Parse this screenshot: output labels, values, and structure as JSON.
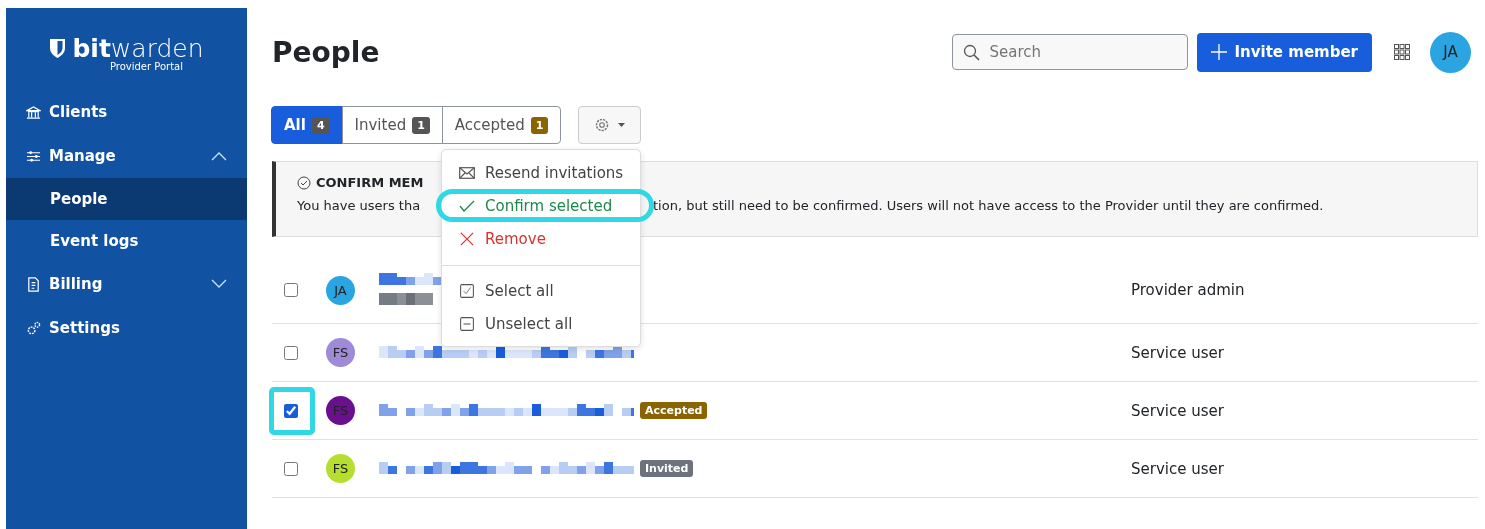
{
  "sidebar": {
    "logo": {
      "brand_bold": "bit",
      "brand_light": "warden",
      "subtitle": "Provider Portal"
    },
    "items": [
      {
        "label": "Clients",
        "selected": false
      },
      {
        "label": "Manage",
        "expanded": true,
        "selected": false,
        "children": [
          {
            "label": "People",
            "selected": true
          },
          {
            "label": "Event logs",
            "selected": false
          }
        ]
      },
      {
        "label": "Billing",
        "expanded": false,
        "selected": false
      },
      {
        "label": "Settings",
        "selected": false
      }
    ]
  },
  "header": {
    "title": "People",
    "search": {
      "placeholder": "Search"
    },
    "invite_button": "Invite member",
    "avatar": "JA"
  },
  "tabs": [
    {
      "label": "All",
      "count": "4",
      "selected": true,
      "color": "#555555"
    },
    {
      "label": "Invited",
      "count": "1",
      "selected": false,
      "color": "#555555"
    },
    {
      "label": "Accepted",
      "count": "1",
      "selected": false,
      "color": "#8a6400"
    }
  ],
  "banner": {
    "title": "CONFIRM MEM",
    "text_before": "You have users tha",
    "text_after": "tion, but still need to be confirmed. Users will not have access to the Provider until they are confirmed."
  },
  "menu": {
    "items": [
      {
        "kind": "envelope",
        "label": "Resend invitations",
        "highlighted": false
      },
      {
        "kind": "check",
        "label": "Confirm selected",
        "highlighted": true
      },
      {
        "kind": "cross",
        "label": "Remove",
        "highlighted": false
      },
      {
        "kind": "divider"
      },
      {
        "kind": "checkbox",
        "label": "Select all",
        "highlighted": false
      },
      {
        "kind": "minusbox",
        "label": "Unselect all",
        "highlighted": false
      }
    ]
  },
  "rows": [
    {
      "avatar": "JA",
      "color": "#2aa5e2",
      "checked": false,
      "highlighted": false,
      "role": "Provider admin"
    },
    {
      "avatar": "FS",
      "color": "#9f8ad8",
      "checked": false,
      "highlighted": false,
      "role": "Service user"
    },
    {
      "avatar": "FS",
      "color": "#6a0f8e",
      "checked": true,
      "highlighted": true,
      "badge": {
        "label": "Accepted",
        "color": "#8a6400"
      },
      "role": "Service user"
    },
    {
      "avatar": "FS",
      "color": "#b6de2e",
      "checked": false,
      "highlighted": false,
      "badge": {
        "label": "Invited",
        "color": "#6c737d"
      },
      "role": "Service user"
    }
  ]
}
